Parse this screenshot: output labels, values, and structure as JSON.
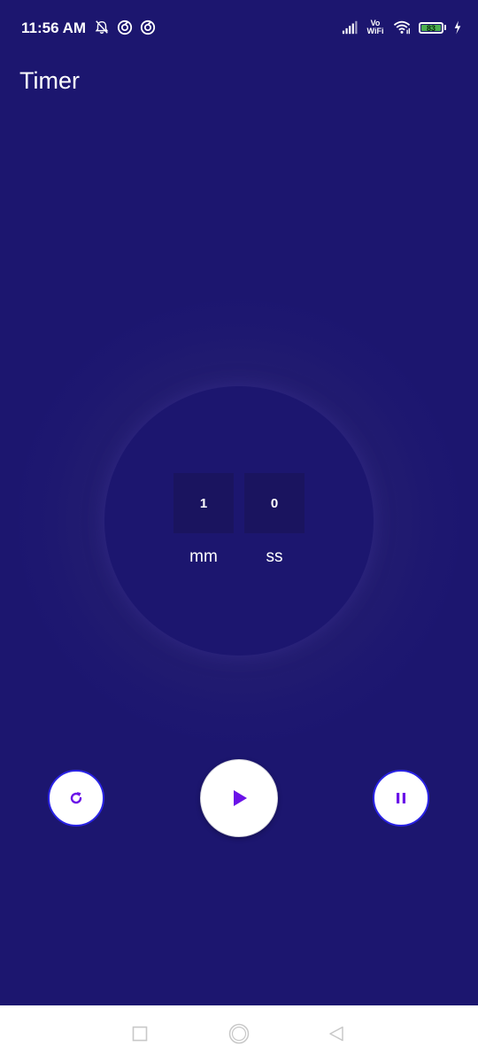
{
  "status_bar": {
    "time": "11:56 AM",
    "left_icons": [
      "muted-bell-icon",
      "app-notification-icon",
      "app-notification-icon"
    ],
    "right_icons": [
      "signal-icon",
      "vowifi-icon",
      "wifi-icon",
      "battery-icon",
      "charging-icon"
    ],
    "vowifi_line1": "Vo",
    "vowifi_line2": "WiFi",
    "battery_level": "83"
  },
  "app": {
    "title": "Timer"
  },
  "timer": {
    "minutes": "1",
    "seconds": "0",
    "minutes_label": "mm",
    "seconds_label": "ss"
  },
  "controls": {
    "reset_icon": "refresh-icon",
    "play_icon": "play-icon",
    "pause_icon": "pause-icon"
  },
  "nav_bar": {
    "icons": [
      "recent-apps-icon",
      "home-icon",
      "back-icon"
    ]
  },
  "colors": {
    "background": "#1c166f",
    "accent": "#6a11e8",
    "button_border": "#2a23e6",
    "time_box": "#1a145f"
  }
}
